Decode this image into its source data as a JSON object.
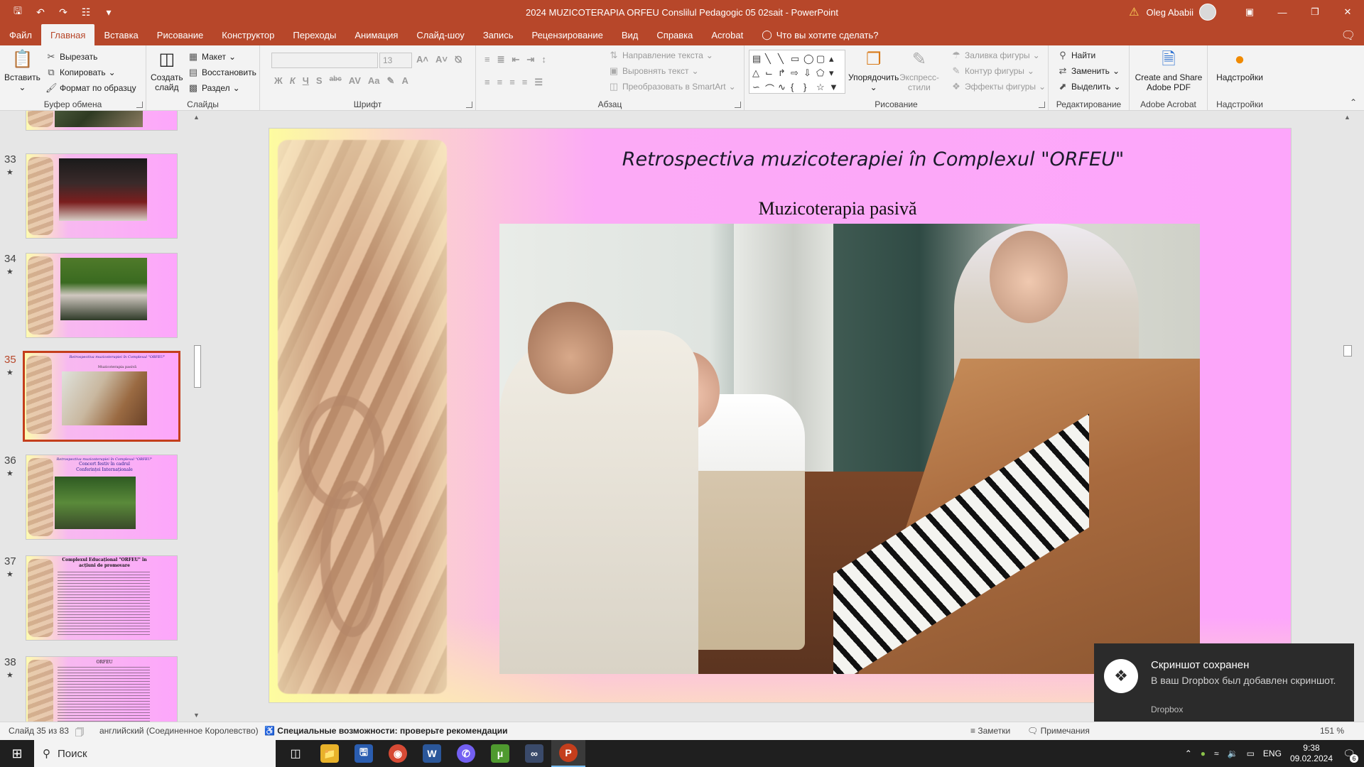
{
  "window": {
    "title": "2024 MUZICOTERAPIA ORFEU Conslilul Pedagogic 05 02sait  -  PowerPoint",
    "user": "Oleg Ababii"
  },
  "tabs": [
    "Файл",
    "Главная",
    "Вставка",
    "Рисование",
    "Конструктор",
    "Переходы",
    "Анимация",
    "Слайд-шоу",
    "Запись",
    "Рецензирование",
    "Вид",
    "Справка",
    "Acrobat"
  ],
  "active_tab": "Главная",
  "tell_me": "Что вы хотите сделать?",
  "ribbon": {
    "clipboard": {
      "paste": "Вставить",
      "cut": "Вырезать",
      "copy": "Копировать",
      "format_painter": "Формат по образцу",
      "label": "Буфер обмена"
    },
    "slides": {
      "new_slide_1": "Создать",
      "new_slide_2": "слайд",
      "layout": "Макет",
      "reset": "Восстановить",
      "section": "Раздел",
      "label": "Слайды"
    },
    "font": {
      "name": "",
      "size": "13",
      "label": "Шрифт"
    },
    "paragraph": {
      "text_direction": "Направление текста",
      "align_text": "Выровнять текст",
      "smartart": "Преобразовать в SmartArt",
      "label": "Абзац"
    },
    "drawing": {
      "arrange": "Упорядочить",
      "quick_styles_1": "Экспресс-",
      "quick_styles_2": "стили",
      "shape_fill": "Заливка фигуры",
      "shape_outline": "Контур фигуры",
      "shape_effects": "Эффекты фигуры",
      "label": "Рисование"
    },
    "editing": {
      "find": "Найти",
      "replace": "Заменить",
      "select": "Выделить",
      "label": "Редактирование"
    },
    "acrobat": {
      "create_1": "Create and Share",
      "create_2": "Adobe PDF",
      "label": "Adobe Acrobat"
    },
    "addins": {
      "addins": "Надстройки",
      "label": "Надстройки"
    }
  },
  "thumbnails": [
    {
      "num": "33",
      "star": "★"
    },
    {
      "num": "34",
      "star": "★"
    },
    {
      "num": "35",
      "star": "★",
      "title": "Retrospectiva muzicoterapiei în Complexul \"ORFEU\"",
      "subtitle": "Muzicoterapia  pasivă"
    },
    {
      "num": "36",
      "star": "★",
      "title": "Retrospectiva muzicoterapiei în Complexul \"ORFEU\"",
      "subtitle": "Concert festiv în cadrul Conferinței Internaționale"
    },
    {
      "num": "37",
      "star": "★",
      "title": "Complexul Educațional \"ORFEU\" în acțiuni de promovare"
    },
    {
      "num": "38",
      "star": "★",
      "title": "ORFEU"
    }
  ],
  "slide": {
    "title": "Retrospectiva muzicoterapiei în Complexul \"ORFEU\"",
    "subtitle": "Muzicoterapia  pasivă"
  },
  "toast": {
    "title": "Скриншот сохранен",
    "body": "В ваш Dropbox был добавлен скриншот.",
    "app": "Dropbox"
  },
  "status": {
    "slide_of": "Слайд 35 из 83",
    "language": "английский (Соединенное Королевство)",
    "accessibility": "Специальные возможности: проверьте рекомендации",
    "notes": "Заметки",
    "comments": "Примечания",
    "zoom": "151 %"
  },
  "taskbar": {
    "search": "Поиск",
    "lang": "ENG",
    "time": "9:38",
    "date": "09.02.2024",
    "notif_count": "6"
  }
}
